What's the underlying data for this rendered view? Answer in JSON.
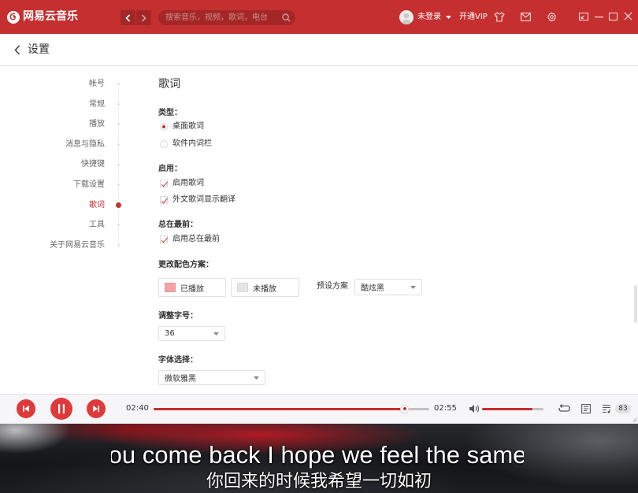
{
  "theme": {
    "accent": "#c62f2f",
    "player_bg": "#f6f6f8"
  },
  "app": {
    "name": "网易云音乐"
  },
  "topbar": {
    "search_placeholder": "搜索音乐，视频，歌词，电台",
    "login_label": "未登录",
    "vip_label": "开通VIP",
    "icons": [
      "netease-logo-icon",
      "chevron-left-icon",
      "chevron-right-icon",
      "search-icon",
      "avatar-icon",
      "chevron-down-icon",
      "skin-icon",
      "mail-icon",
      "settings-icon",
      "mini-mode-icon",
      "minimize-icon",
      "maximize-icon",
      "close-icon"
    ]
  },
  "header": {
    "title": "设置"
  },
  "nav": {
    "items": [
      {
        "label": "帐号",
        "active": false
      },
      {
        "label": "常规",
        "active": false
      },
      {
        "label": "播放",
        "active": false
      },
      {
        "label": "消息与隐私",
        "active": false
      },
      {
        "label": "快捷键",
        "active": false
      },
      {
        "label": "下载设置",
        "active": false
      },
      {
        "label": "歌词",
        "active": true
      },
      {
        "label": "工具",
        "active": false
      },
      {
        "label": "关于网易云音乐",
        "active": false
      }
    ]
  },
  "lyrics": {
    "title": "歌词",
    "type": {
      "label": "类型：",
      "options": [
        {
          "label": "桌面歌词",
          "selected": true
        },
        {
          "label": "软件内词栏",
          "selected": false
        }
      ]
    },
    "enable": {
      "label": "启用：",
      "options": [
        {
          "label": "启用歌词",
          "checked": true
        },
        {
          "label": "外文歌词显示翻译",
          "checked": true
        }
      ]
    },
    "always_on_top": {
      "label": "总在最前：",
      "options": [
        {
          "label": "启用总在最前",
          "checked": true
        }
      ]
    },
    "color_scheme": {
      "label": "更改配色方案：",
      "played_label": "已播放",
      "played_color": "#f4a3a7",
      "unplayed_label": "未播放",
      "unplayed_color": "#e6e6e8",
      "preset_label": "预设方案",
      "preset_value": "酷炫黑"
    },
    "font_size": {
      "label": "调整字号：",
      "value": "36"
    },
    "font_family": {
      "label": "字体选择：",
      "value": "微软雅黑"
    }
  },
  "player": {
    "button_color": "#e0393a",
    "elapsed": "02:40",
    "duration": "02:55",
    "progress": 0.91,
    "volume": 0.82,
    "playlist_count": "83",
    "icons": [
      "previous-icon",
      "pause-icon",
      "next-icon",
      "volume-icon",
      "loop-icon",
      "lyrics-icon",
      "playlist-icon"
    ]
  },
  "desktop_lyrics": {
    "line": "ou come back I hope we feel the same",
    "translation": "你回来的时候我希望一切如初"
  }
}
